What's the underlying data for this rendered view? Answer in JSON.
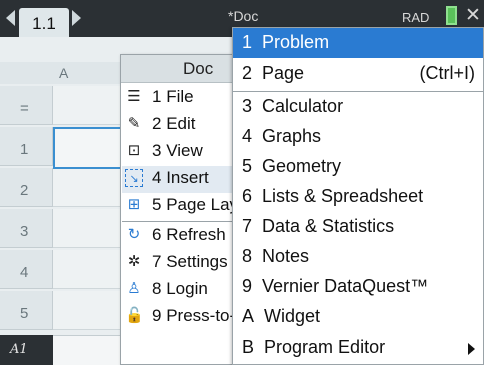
{
  "tabbar": {
    "tab_label": "1.1",
    "doc_title": "*Doc",
    "angle_mode": "RAD"
  },
  "sheet": {
    "column_header": "A",
    "row_headers": [
      "=",
      "1",
      "2",
      "3",
      "4",
      "5"
    ],
    "cell_ref": "A1"
  },
  "doc_menu": {
    "title": "Doc",
    "items": [
      {
        "num": "1",
        "label": "File",
        "icon": "file-icon"
      },
      {
        "num": "2",
        "label": "Edit",
        "icon": "pencil-icon"
      },
      {
        "num": "3",
        "label": "View",
        "icon": "view-icon"
      },
      {
        "num": "4",
        "label": "Insert",
        "icon": "insert-icon"
      },
      {
        "num": "5",
        "label": "Page Layout",
        "icon": "page-layout-icon"
      },
      {
        "num": "6",
        "label": "Refresh",
        "icon": "refresh-icon"
      },
      {
        "num": "7",
        "label": "Settings",
        "icon": "gear-icon"
      },
      {
        "num": "8",
        "label": "Login",
        "icon": "user-icon"
      },
      {
        "num": "9",
        "label": "Press-to-Test",
        "icon": "lock-icon"
      }
    ]
  },
  "insert_menu": {
    "items": [
      {
        "key": "1",
        "label": "Problem",
        "shortcut": "",
        "highlighted": true
      },
      {
        "key": "2",
        "label": "Page",
        "shortcut": "(Ctrl+I)"
      },
      {
        "key": "3",
        "label": "Calculator",
        "shortcut": ""
      },
      {
        "key": "4",
        "label": "Graphs",
        "shortcut": ""
      },
      {
        "key": "5",
        "label": "Geometry",
        "shortcut": ""
      },
      {
        "key": "6",
        "label": "Lists & Spreadsheet",
        "shortcut": ""
      },
      {
        "key": "7",
        "label": "Data & Statistics",
        "shortcut": ""
      },
      {
        "key": "8",
        "label": "Notes",
        "shortcut": ""
      },
      {
        "key": "9",
        "label": "Vernier DataQuest™",
        "shortcut": ""
      },
      {
        "key": "A",
        "label": "Widget",
        "shortcut": ""
      },
      {
        "key": "B",
        "label": "Program Editor",
        "shortcut": "",
        "has_submenu": true
      }
    ]
  },
  "colors": {
    "highlight": "#2a7bd2",
    "tabbar_bg": "#2b3034",
    "selected_cell_border": "#3a8fd0"
  }
}
